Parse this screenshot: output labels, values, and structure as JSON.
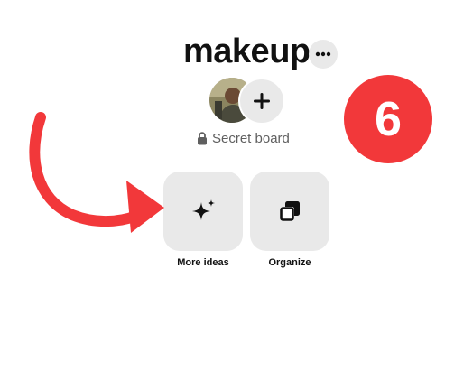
{
  "board": {
    "title": "makeup",
    "privacy_label": "Secret board"
  },
  "actions": [
    {
      "label": "More ideas",
      "icon": "sparkle-icon"
    },
    {
      "label": "Organize",
      "icon": "organize-icon"
    }
  ],
  "annotation": {
    "step_number": "6",
    "badge_color": "#f2383a",
    "arrow_color": "#f2383a"
  },
  "icons": {
    "more": "more-options-icon",
    "add": "plus-icon",
    "privacy": "lock-icon"
  }
}
